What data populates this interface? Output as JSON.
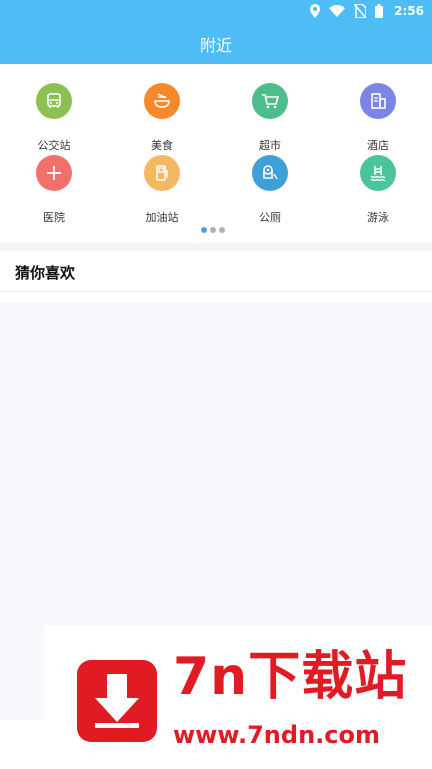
{
  "status_bar": {
    "time": "2:56",
    "icons": [
      "location-icon",
      "wifi-icon",
      "no-signal-icon",
      "battery-icon"
    ]
  },
  "header": {
    "title": "附近"
  },
  "categories": [
    {
      "label": "公交站",
      "icon": "bus-icon",
      "color": "#8cc152"
    },
    {
      "label": "美食",
      "icon": "noodles-icon",
      "color": "#f5892a"
    },
    {
      "label": "超市",
      "icon": "cart-icon",
      "color": "#4dbd8c"
    },
    {
      "label": "酒店",
      "icon": "hotel-icon",
      "color": "#7b84e8"
    },
    {
      "label": "医院",
      "icon": "hospital-cross-icon",
      "color": "#f2706b"
    },
    {
      "label": "加油站",
      "icon": "fuel-pump-icon",
      "color": "#f5b862"
    },
    {
      "label": "公厕",
      "icon": "toilet-paper-icon",
      "color": "#3fa0d9"
    },
    {
      "label": "游泳",
      "icon": "swimming-pool-icon",
      "color": "#4bc49a"
    }
  ],
  "pager": {
    "pages": 3,
    "active_index": 0
  },
  "recommend": {
    "title": "猜你喜欢"
  },
  "watermark": {
    "name": "7n下载站",
    "url": "www.7ndn.com",
    "icon": "download-arrow-icon",
    "color": "#e01b23"
  }
}
